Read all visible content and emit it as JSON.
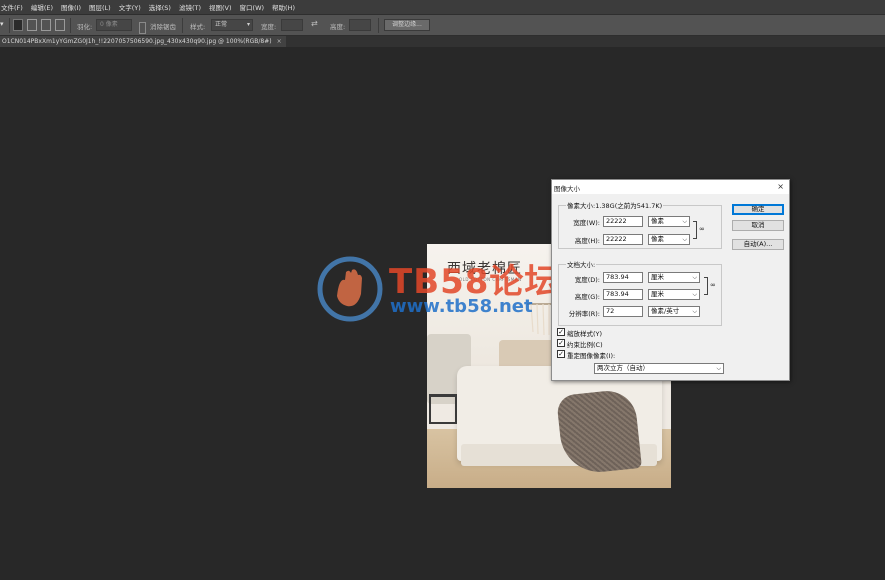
{
  "menu": [
    "文件(F)",
    "编辑(E)",
    "图像(I)",
    "图层(L)",
    "文字(Y)",
    "选择(S)",
    "滤镜(T)",
    "视图(V)",
    "窗口(W)",
    "帮助(H)"
  ],
  "options": {
    "feather_label": "羽化:",
    "feather_value": "0 像素",
    "antialias_label": "消除锯齿",
    "style_label": "样式:",
    "style_value": "正常",
    "width_label": "宽度:",
    "height_label": "高度:",
    "refine_button": "调整边缘..."
  },
  "doc_tab": {
    "title": "O1CN014PBxXm1yYGmZG0J1h_!!2207057506590.jpg_430x430q90.jpg @ 100%(RGB/8#)",
    "close": "×"
  },
  "image": {
    "brand_cn": "西域老棉匠",
    "brand_en": "OLD COTTON CRAFTSMAN"
  },
  "watermark": {
    "text1": "TB58论坛",
    "text2": "www.tb58.net"
  },
  "dialog": {
    "title": "图像大小",
    "close": "×",
    "pixel_dims": {
      "title": "像素大小:1.38G(之前为541.7K)",
      "width_label": "宽度(W):",
      "width_value": "22222",
      "width_unit": "像素",
      "height_label": "高度(H):",
      "height_value": "22222",
      "height_unit": "像素"
    },
    "doc_size": {
      "title": "文档大小:",
      "width_label": "宽度(D):",
      "width_value": "783.94",
      "width_unit": "厘米",
      "height_label": "高度(G):",
      "height_value": "783.94",
      "height_unit": "厘米",
      "res_label": "分辨率(R):",
      "res_value": "72",
      "res_unit": "像素/英寸"
    },
    "checkboxes": [
      {
        "label": "缩放样式(Y)",
        "checked": true
      },
      {
        "label": "约束比例(C)",
        "checked": true
      },
      {
        "label": "重定图像像素(I):",
        "checked": true
      }
    ],
    "resample_value": "两次立方（自动）",
    "ok_button": "确定",
    "cancel_button": "取消",
    "auto_button": "自动(A)..."
  }
}
